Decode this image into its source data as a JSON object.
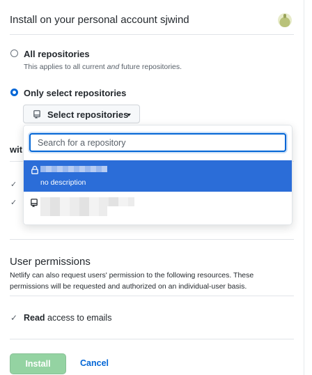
{
  "header": {
    "title": "Install on your personal account sjwind"
  },
  "repo_access": {
    "all": {
      "label": "All repositories",
      "desc_prefix": "This applies to all current ",
      "desc_em": "and",
      "desc_suffix": " future repositories.",
      "selected": false
    },
    "select": {
      "label": "Only select repositories",
      "selected": true
    },
    "select_button": {
      "label": "Select repositories",
      "icon": "repo-icon"
    }
  },
  "dropdown": {
    "search": {
      "placeholder": "Search for a repository",
      "value": ""
    },
    "items": [
      {
        "icon": "lock-icon",
        "name_redacted": true,
        "description": "no description",
        "selected": true
      },
      {
        "icon": "repo-icon",
        "name_redacted": true,
        "selected": false
      }
    ]
  },
  "behind": {
    "partial_heading": "wit"
  },
  "user_permissions": {
    "title": "User permissions",
    "description": "Netlify can also request users' permission to the following resources. These permissions will be requested and authorized on an individual-user basis.",
    "items": [
      {
        "bold": "Read",
        "rest": " access to emails",
        "icon": "check-icon"
      }
    ]
  },
  "actions": {
    "install_label": "Install",
    "cancel_label": "Cancel",
    "install_enabled": false
  },
  "colors": {
    "accent": "#0366d6",
    "selected_row": "#2b6dd8",
    "install_disabled": "#94d3a2"
  }
}
